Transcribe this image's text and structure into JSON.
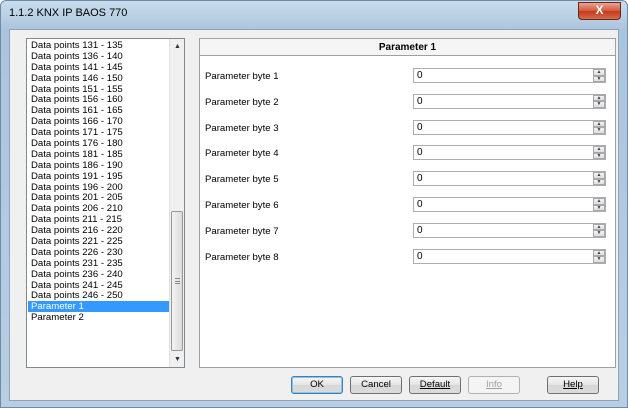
{
  "window": {
    "title": "1.1.2 KNX IP BAOS 770",
    "close_glyph": "X"
  },
  "list": {
    "items": [
      "Data points 131 - 135",
      "Data points 136 - 140",
      "Data points 141 - 145",
      "Data points 146 - 150",
      "Data points 151 - 155",
      "Data points 156 - 160",
      "Data points 161 - 165",
      "Data points 166 - 170",
      "Data points 171 - 175",
      "Data points 176 - 180",
      "Data points 181 - 185",
      "Data points 186 - 190",
      "Data points 191 - 195",
      "Data points 196 - 200",
      "Data points 201 - 205",
      "Data points 206 - 210",
      "Data points 211 - 215",
      "Data points 216 - 220",
      "Data points 221 - 225",
      "Data points 226 - 230",
      "Data points 231 - 235",
      "Data points 236 - 240",
      "Data points 241 - 245",
      "Data points 246 - 250",
      "Parameter 1",
      "Parameter 2"
    ],
    "selected_index": 24
  },
  "panel": {
    "title": "Parameter 1",
    "params": [
      {
        "label": "Parameter byte 1",
        "value": "0"
      },
      {
        "label": "Parameter byte 2",
        "value": "0"
      },
      {
        "label": "Parameter byte 3",
        "value": "0"
      },
      {
        "label": "Parameter byte 4",
        "value": "0"
      },
      {
        "label": "Parameter byte 5",
        "value": "0"
      },
      {
        "label": "Parameter byte 6",
        "value": "0"
      },
      {
        "label": "Parameter byte 7",
        "value": "0"
      },
      {
        "label": "Parameter byte 8",
        "value": "0"
      }
    ]
  },
  "buttons": {
    "ok": "OK",
    "cancel": "Cancel",
    "default": "Default",
    "info": "Info",
    "help": "Help"
  },
  "colors": {
    "selection": "#3399ff",
    "close_button": "#c43a1c"
  }
}
